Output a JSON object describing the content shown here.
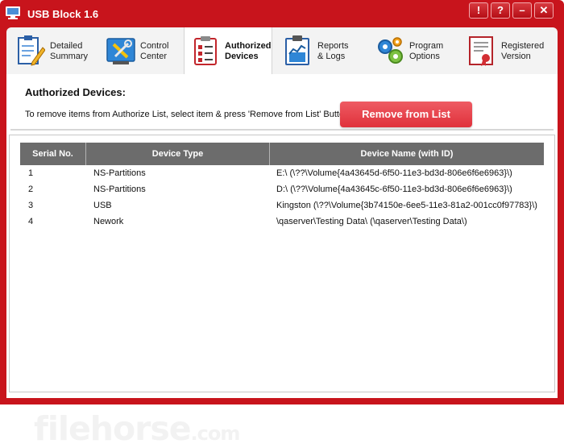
{
  "window": {
    "title": "USB Block 1.6",
    "help_label": "!",
    "question_label": "?",
    "minimize_label": "–",
    "close_label": "✕"
  },
  "tabs": [
    {
      "label": "Detailed\nSummary",
      "icon": "clipboard-pencil-icon"
    },
    {
      "label": "Control\nCenter",
      "icon": "tools-icon"
    },
    {
      "label": "Authorized\nDevices",
      "icon": "checklist-icon",
      "active": true
    },
    {
      "label": "Reports\n& Logs",
      "icon": "chart-report-icon"
    },
    {
      "label": "Program\nOptions",
      "icon": "gears-icon"
    },
    {
      "label": "Registered\nVersion",
      "icon": "certificate-icon"
    }
  ],
  "page": {
    "title": "Authorized Devices:",
    "instruction": "To remove items from Authorize List, select item & press 'Remove from List' Button.",
    "remove_button": "Remove from List"
  },
  "table": {
    "headers": [
      "Serial No.",
      "Device Type",
      "Device Name (with ID)"
    ],
    "rows": [
      [
        "1",
        "NS-Partitions",
        "E:\\ (\\??\\Volume{4a43645d-6f50-11e3-bd3d-806e6f6e6963}\\)"
      ],
      [
        "2",
        "NS-Partitions",
        "D:\\ (\\??\\Volume{4a43645c-6f50-11e3-bd3d-806e6f6e6963}\\)"
      ],
      [
        "3",
        "USB",
        "Kingston (\\??\\Volume{3b74150e-6ee5-11e3-81a2-001cc0f97783}\\)"
      ],
      [
        "4",
        "Nework",
        "\\qaserver\\Testing Data\\ (\\qaserver\\Testing Data\\)"
      ]
    ]
  },
  "watermark": {
    "main": "filehorse",
    "suffix": ".com"
  },
  "colors": {
    "title_bar": "#c8141c",
    "button": "#e0313b",
    "header_cell": "#6c6c6c"
  }
}
